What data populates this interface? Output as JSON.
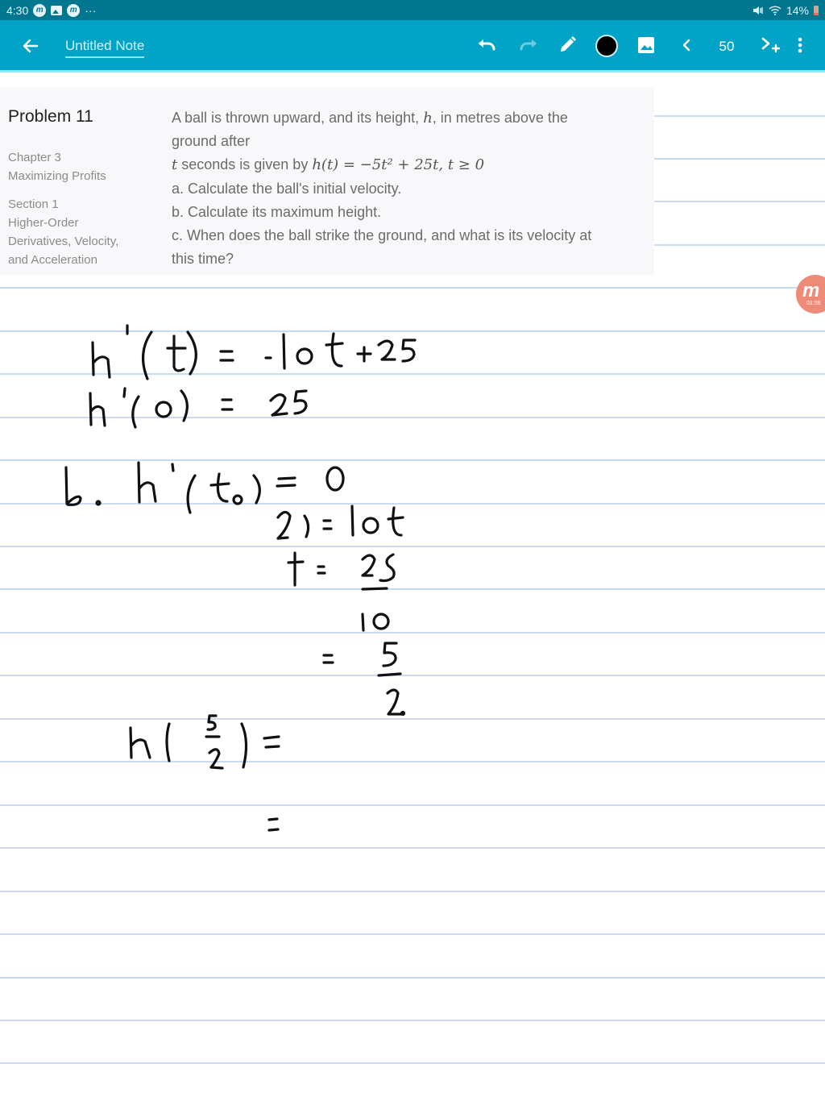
{
  "status_bar": {
    "time": "4:30",
    "left_icons": [
      "app-m-icon",
      "image-icon",
      "app-m-icon",
      "more-dots-icon"
    ],
    "more": "···",
    "right_icons": [
      "mute-icon",
      "wifi-icon"
    ],
    "battery_percent": "14%"
  },
  "toolbar": {
    "title": "Untitled Note",
    "page_number": "50",
    "pen_color": "#000000",
    "accent_color": "#01a4c6",
    "icons": [
      "back-arrow-icon",
      "undo-icon",
      "redo-icon",
      "pen-icon",
      "color-swatch",
      "image-insert-icon",
      "prev-page-icon",
      "add-page-icon",
      "overflow-menu-icon"
    ]
  },
  "problem": {
    "title": "Problem 11",
    "chapter_label": "Chapter 3",
    "chapter_name": "Maximizing Profits",
    "section_label": "Section 1",
    "section_name_lines": [
      "Higher-Order",
      "Derivatives, Velocity,",
      "and Acceleration"
    ],
    "text_line1_pre": "A ball is thrown upward, and its height,",
    "text_line1_var": "h",
    "text_line1_post": ", in metres above the",
    "text_line2": "ground after",
    "text_line3_var": "t",
    "text_line3_pre": " seconds is given by ",
    "text_line3_formula": "h(t) = −5t² + 25t, t ≥ 0",
    "part_a": "a. Calculate the ball's initial velocity.",
    "part_b": "b. Calculate its maximum height.",
    "part_c_line1": "c. When does the ball strike the ground, and what is its velocity at",
    "part_c_line2": "this time?"
  },
  "handwriting": [
    "h'(t) = -10t + 25",
    "h'(0) = 25",
    "b. h'(t₀) = 0",
    "25 = 10t",
    "t = 25/10",
    "= 5/2",
    "h(5/2) =",
    "="
  ],
  "recording_badge": {
    "label": "m",
    "timer": "01:55"
  }
}
